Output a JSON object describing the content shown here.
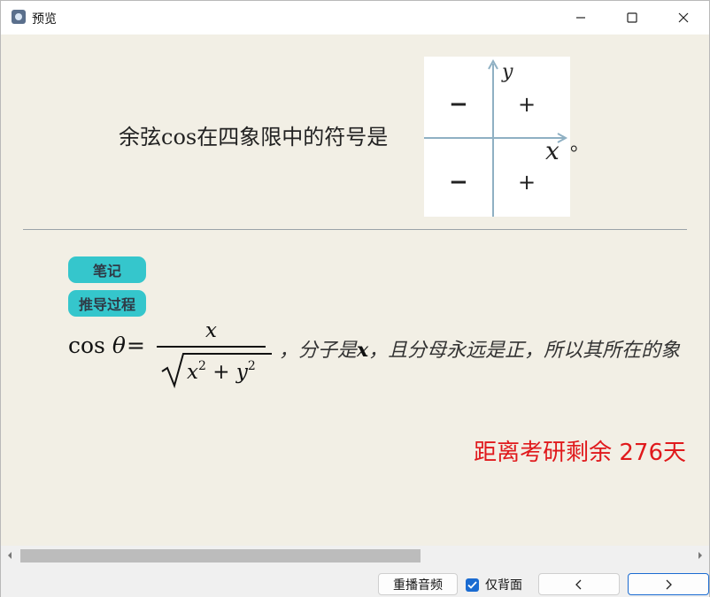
{
  "window": {
    "title": "预览",
    "controls": [
      "minimize-icon",
      "maximize-icon",
      "close-icon"
    ]
  },
  "card": {
    "question_text": "余弦cos在四象限中的符号是",
    "question_end": "。",
    "quadrant_figure": {
      "axis_y_label": "y",
      "axis_x_label": "x",
      "q2_sign": "−",
      "q1_sign": "+",
      "q3_sign": "−",
      "q4_sign": "+"
    },
    "notes_label": "笔记",
    "derivation_label": "推导过程",
    "formula": {
      "lhs_func": "cos",
      "lhs_var": "θ",
      "equals": "=",
      "numerator": "x",
      "denominator_x": "x",
      "denominator_x_exp": "2",
      "denominator_plus": " + ",
      "denominator_y": "y",
      "denominator_y_exp": "2",
      "explanation_prefix": "，分子是",
      "explanation_var": "x",
      "explanation_suffix": "，且分母永远是正，所以其所在的象"
    },
    "countdown": "距离考研剩余 276天"
  },
  "footer": {
    "replay_button": "重播音频",
    "back_only_checkbox": {
      "label": "仅背面",
      "checked": true
    },
    "prev_button_icon": "chevron-left-icon",
    "next_button_icon": "chevron-right-icon"
  },
  "colors": {
    "pill": "#35c6cc",
    "countdown": "#e0191c",
    "checkbox": "#1a6bd1",
    "content_bg": "#f2efe5"
  }
}
